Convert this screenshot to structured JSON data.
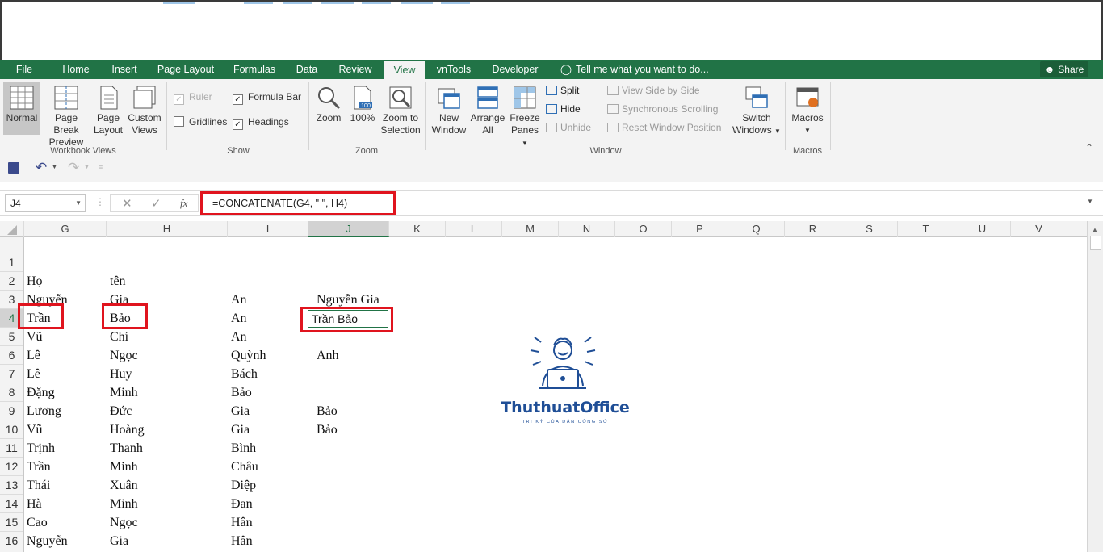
{
  "ribbon_tabs": [
    "File",
    "Home",
    "Insert",
    "Page Layout",
    "Formulas",
    "Data",
    "Review",
    "View",
    "vnTools",
    "Developer"
  ],
  "active_tab": "View",
  "tell_me": "Tell me what you want to do...",
  "share": "Share",
  "workbook_views": {
    "normal": "Normal",
    "page_break_1": "Page Break",
    "page_break_2": "Preview",
    "page_layout_1": "Page",
    "page_layout_2": "Layout",
    "custom_views_1": "Custom",
    "custom_views_2": "Views",
    "group": "Workbook Views"
  },
  "show": {
    "ruler": "Ruler",
    "formula_bar": "Formula Bar",
    "gridlines": "Gridlines",
    "headings": "Headings",
    "group": "Show"
  },
  "zoom": {
    "zoom": "Zoom",
    "hundred": "100%",
    "zoom_sel_1": "Zoom to",
    "zoom_sel_2": "Selection",
    "group": "Zoom"
  },
  "window": {
    "new_window_1": "New",
    "new_window_2": "Window",
    "arrange_1": "Arrange",
    "arrange_2": "All",
    "freeze_1": "Freeze",
    "freeze_2": "Panes",
    "split": "Split",
    "hide": "Hide",
    "unhide": "Unhide",
    "side_by_side": "View Side by Side",
    "sync_scroll": "Synchronous Scrolling",
    "reset_pos": "Reset Window Position",
    "switch_1": "Switch",
    "switch_2": "Windows",
    "group": "Window"
  },
  "macros": {
    "label": "Macros",
    "group": "Macros"
  },
  "name_box": "J4",
  "formula": "=CONCATENATE(G4, \" \", H4)",
  "fx": "fx",
  "columns": [
    "G",
    "H",
    "I",
    "J",
    "K",
    "L",
    "M",
    "N",
    "O",
    "P",
    "Q",
    "R",
    "S",
    "T",
    "U",
    "V"
  ],
  "rows": [
    {
      "n": "1",
      "g": "",
      "h": "",
      "i": "",
      "j": ""
    },
    {
      "n": "2",
      "g": "Họ",
      "h": "tên",
      "i": "",
      "j": ""
    },
    {
      "n": "3",
      "g": "Nguyễn",
      "h": "Gia",
      "i": "An",
      "j": "Nguyễn Gia"
    },
    {
      "n": "4",
      "g": "Trần",
      "h": "Bảo",
      "i": "An",
      "j": "Trần Bảo"
    },
    {
      "n": "5",
      "g": "Vũ",
      "h": "Chí",
      "i": "An",
      "j": ""
    },
    {
      "n": "6",
      "g": "Lê",
      "h": "Ngọc",
      "i": "Quỳnh",
      "j": "Anh"
    },
    {
      "n": "7",
      "g": "Lê",
      "h": "Huy",
      "i": "Bách",
      "j": ""
    },
    {
      "n": "8",
      "g": "Đặng",
      "h": "Minh",
      "i": "Bảo",
      "j": ""
    },
    {
      "n": "9",
      "g": "Lương",
      "h": "Đức",
      "i": "Gia",
      "j": "Bảo"
    },
    {
      "n": "10",
      "g": "Vũ",
      "h": "Hoàng",
      "i": "Gia",
      "j": "Bảo"
    },
    {
      "n": "11",
      "g": "Trịnh",
      "h": "Thanh",
      "i": "Bình",
      "j": ""
    },
    {
      "n": "12",
      "g": "Trần",
      "h": "Minh",
      "i": "Châu",
      "j": ""
    },
    {
      "n": "13",
      "g": "Thái",
      "h": "Xuân",
      "i": "Diệp",
      "j": ""
    },
    {
      "n": "14",
      "g": "Hà",
      "h": "Minh",
      "i": "Đan",
      "j": ""
    },
    {
      "n": "15",
      "g": "Cao",
      "h": "Ngọc",
      "i": "Hân",
      "j": ""
    },
    {
      "n": "16",
      "g": "Nguyễn",
      "h": "Gia",
      "i": "Hân",
      "j": ""
    }
  ],
  "logo": {
    "name": "ThuthuatOffice",
    "tagline": "TRI KỶ CỦA DÂN CÔNG SỞ"
  },
  "colors": {
    "excel_green": "#217346",
    "highlight_red": "#e0141e",
    "logo_blue": "#1f4e96"
  }
}
